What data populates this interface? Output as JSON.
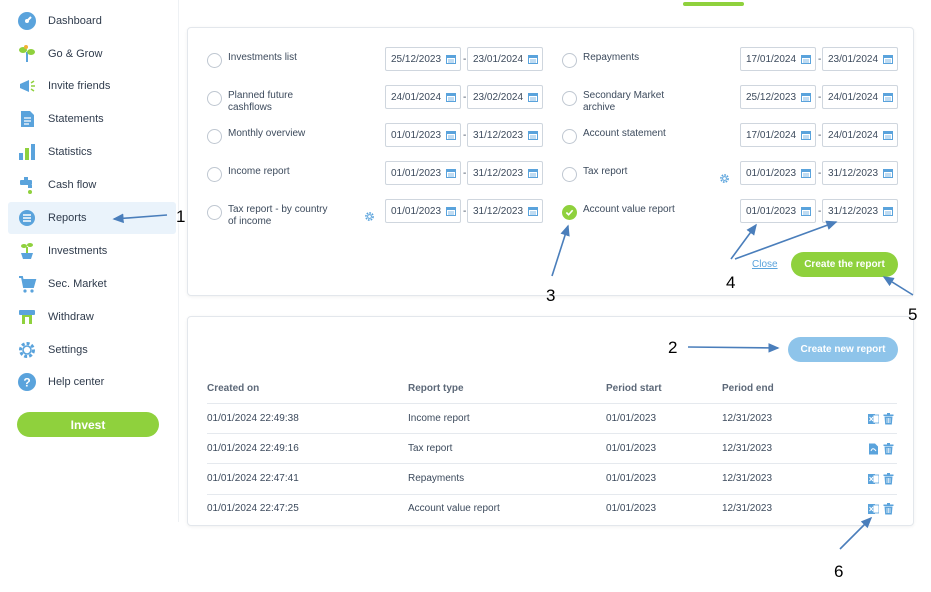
{
  "sidebar": {
    "items": [
      {
        "label": "Dashboard",
        "icon": "dashboard-icon"
      },
      {
        "label": "Go & Grow",
        "icon": "plant-icon"
      },
      {
        "label": "Invite friends",
        "icon": "megaphone-icon"
      },
      {
        "label": "Statements",
        "icon": "document-icon"
      },
      {
        "label": "Statistics",
        "icon": "bar-chart-icon"
      },
      {
        "label": "Cash flow",
        "icon": "tap-icon"
      },
      {
        "label": "Reports",
        "icon": "reports-icon"
      },
      {
        "label": "Investments",
        "icon": "sprout-icon"
      },
      {
        "label": "Sec. Market",
        "icon": "cart-icon"
      },
      {
        "label": "Withdraw",
        "icon": "atm-icon"
      },
      {
        "label": "Settings",
        "icon": "gear-icon"
      },
      {
        "label": "Help center",
        "icon": "help-icon"
      }
    ],
    "active": "Reports",
    "invest_label": "Invest"
  },
  "report_options": [
    {
      "label_lines": [
        "Investments list"
      ],
      "from": "25/12/2023",
      "to": "23/01/2024",
      "checked": false,
      "settings": false
    },
    {
      "label_lines": [
        "Planned future",
        "cashflows"
      ],
      "from": "24/01/2024",
      "to": "23/02/2024",
      "checked": false,
      "settings": false
    },
    {
      "label_lines": [
        "Monthly overview"
      ],
      "from": "01/01/2023",
      "to": "31/12/2023",
      "checked": false,
      "settings": false
    },
    {
      "label_lines": [
        "Income report"
      ],
      "from": "01/01/2023",
      "to": "31/12/2023",
      "checked": false,
      "settings": false
    },
    {
      "label_lines": [
        "Tax report - by country",
        "of income"
      ],
      "from": "01/01/2023",
      "to": "31/12/2023",
      "checked": false,
      "settings": true
    },
    {
      "label_lines": [
        "Repayments"
      ],
      "from": "17/01/2024",
      "to": "23/01/2024",
      "checked": false,
      "settings": false
    },
    {
      "label_lines": [
        "Secondary Market",
        "archive"
      ],
      "from": "25/12/2023",
      "to": "24/01/2024",
      "checked": false,
      "settings": false
    },
    {
      "label_lines": [
        "Account statement"
      ],
      "from": "17/01/2024",
      "to": "24/01/2024",
      "checked": false,
      "settings": false
    },
    {
      "label_lines": [
        "Tax report"
      ],
      "from": "01/01/2023",
      "to": "31/12/2023",
      "checked": false,
      "settings": true
    },
    {
      "label_lines": [
        "Account value report"
      ],
      "from": "01/01/2023",
      "to": "31/12/2023",
      "checked": true,
      "settings": false
    }
  ],
  "actions": {
    "close_label": "Close",
    "create_report_label": "Create the report",
    "create_new_report_label": "Create new report"
  },
  "table": {
    "headers": [
      "Created on",
      "Report type",
      "Period start",
      "Period end"
    ],
    "rows": [
      {
        "created": "01/01/2024 22:49:38",
        "type": "Income report",
        "start": "01/01/2023",
        "end": "12/31/2023",
        "file": "excel"
      },
      {
        "created": "01/01/2024 22:49:16",
        "type": "Tax report",
        "start": "01/01/2023",
        "end": "12/31/2023",
        "file": "pdf"
      },
      {
        "created": "01/01/2024 22:47:41",
        "type": "Repayments",
        "start": "01/01/2023",
        "end": "12/31/2023",
        "file": "excel"
      },
      {
        "created": "01/01/2024 22:47:25",
        "type": "Account value report",
        "start": "01/01/2023",
        "end": "12/31/2023",
        "file": "excel"
      }
    ]
  },
  "annotations": [
    "1",
    "2",
    "3",
    "4",
    "5",
    "6"
  ],
  "colors": {
    "accent_green": "#8fd13d",
    "accent_blue": "#5aa3dc",
    "annotation_arrow": "#4a7ebb"
  }
}
